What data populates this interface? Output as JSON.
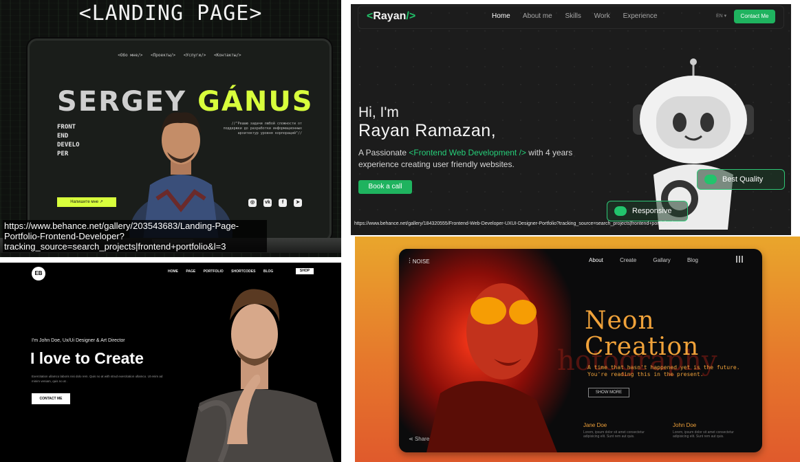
{
  "panel1": {
    "heading": "<LANDING PAGE>",
    "nav": [
      "<Обо мне/>",
      "<Проекты/>",
      "<Услуги/>",
      "<Контакты/>"
    ],
    "name_first": "SERGEY",
    "name_last": "GÁNUS",
    "role_lines": [
      "FRONT",
      "END",
      "DEVELO",
      "PER"
    ],
    "quote": "//\"Решаю задачи любой сложности от поддержки до разработки информационных архитектур уровня корпораций\"//",
    "cta": "Напишите мне ↗",
    "socials": [
      "instagram-icon",
      "vk-icon",
      "facebook-icon",
      "telegram-icon"
    ],
    "source_url": "https://www.behance.net/gallery/203543683/Landing-Page-Portfolio-Frontend-Developer?tracking_source=search_projects|frontend+portfolio&l=3",
    "accent": "#d8ff3c"
  },
  "panel2": {
    "logo_text": "Rayan",
    "logo_open": "<",
    "logo_close": "/>",
    "menu": [
      "Home",
      "About me",
      "Skills",
      "Work",
      "Experience"
    ],
    "lang": "EN ▾",
    "contact_label": "Contact Me",
    "hi": "Hi, I'm",
    "full_name": "Rayan Ramazan,",
    "desc_prefix": "A Passionate ",
    "desc_highlight": "<Frontend Web Development />",
    "desc_suffix": " with 4 years experience creating user friendly websites.",
    "book_label": "Book a call",
    "badge_quality": "Best Quality",
    "badge_responsive": "Responsive",
    "source_url": "https://www.behance.net/gallery/184320555/Frontend-Web-Developer-UXUI-Designer-Portfolio?tracking_source=search_projects|frontend+portfolio&l=1",
    "accent": "#1fb35f"
  },
  "panel3": {
    "logo": "EB",
    "menu": [
      "HOME",
      "PAGE",
      "PORTFOLIO",
      "SHORTCODES",
      "BLOG"
    ],
    "shop_label": "SHOP",
    "tagline": "I'm John Doe, Ux/Ui Designer & Art Director",
    "headline": "I love to Create",
    "body": "Exercitation ullamco laboris nisi dolo rem. Quis no at with strud exercitation ullamco. Ut enim ad minim veniam, quis no at .",
    "contact_label": "CONTACT ME"
  },
  "panel4": {
    "brand": "NOISE",
    "menu": [
      "About",
      "Create",
      "Gallary",
      "Blog"
    ],
    "watermark": "hotography",
    "title_line1": "Neon",
    "title_line2": "Creation",
    "sub_line1": "A time that hasn't happened yet is the future.",
    "sub_line2": "You're reading this in the present.",
    "show_more": "SHOW MORE",
    "person1_name": "Jane Doe",
    "person1_text": "Lorem, ipsum dolor sit amet consectetur adipisicing elit. Sunt rem aut quis.",
    "person2_name": "John Doe",
    "person2_text": "Lorem, ipsum dolor sit amet consectetur adipisicing elit. Sunt rem aut quis.",
    "share_label": "Share",
    "accent": "#f0a23a"
  }
}
